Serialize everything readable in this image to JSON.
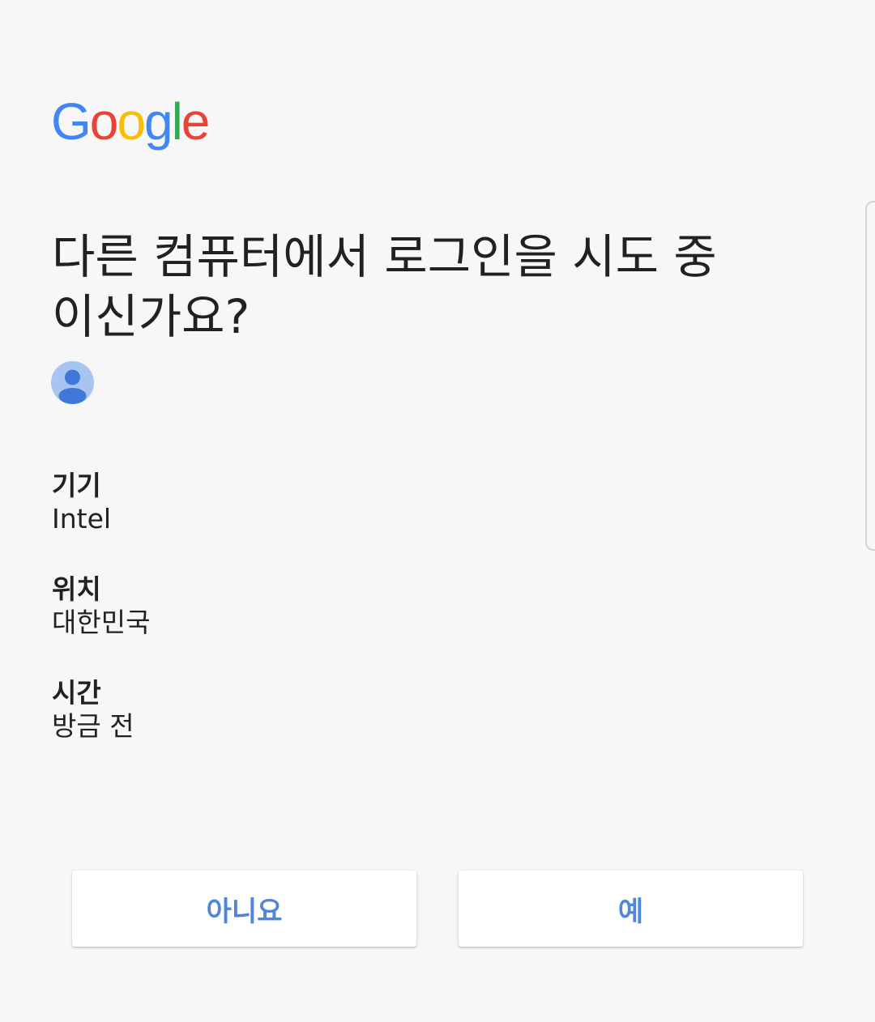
{
  "logo": {
    "letters": [
      {
        "char": "G",
        "color": "#4285F4"
      },
      {
        "char": "o",
        "color": "#EA4335"
      },
      {
        "char": "o",
        "color": "#FBBC05"
      },
      {
        "char": "g",
        "color": "#4285F4"
      },
      {
        "char": "l",
        "color": "#34A853"
      },
      {
        "char": "e",
        "color": "#EA4335"
      }
    ]
  },
  "prompt": {
    "title": "다른 컴퓨터에서 로그인을 시도 중이신가요?"
  },
  "account": {
    "avatar_icon": "person-icon"
  },
  "details": {
    "device_label": "기기",
    "device_value": "Intel",
    "location_label": "위치",
    "location_value": "대한민국",
    "time_label": "시간",
    "time_value": "방금 전"
  },
  "actions": {
    "no_label": "아니요",
    "yes_label": "예"
  },
  "colors": {
    "accent": "#4f86d9",
    "background": "#f7f7f7",
    "avatar_bg": "#a7c4f2",
    "avatar_fg": "#3f78d6"
  }
}
